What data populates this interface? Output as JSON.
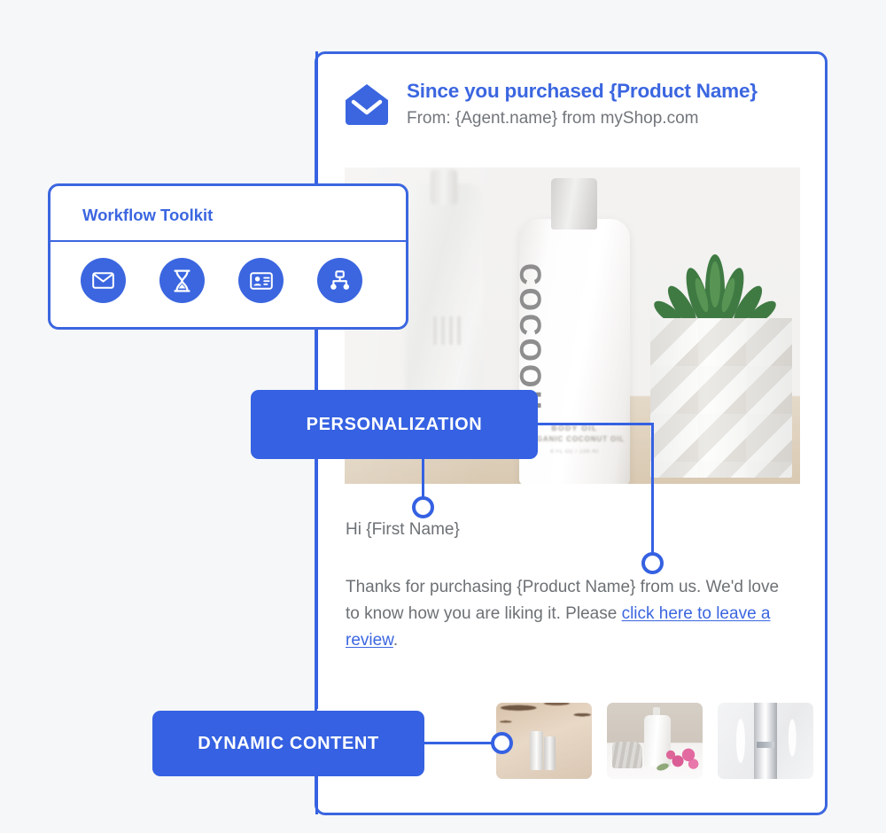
{
  "page": {
    "background_color": "#f6f7f8",
    "accent_color": "#3561e2"
  },
  "email_card": {
    "header": {
      "icon": "open-envelope-icon",
      "subject": "Since you purchased {Product Name}",
      "from": "From: {Agent.name} from myShop.com"
    },
    "hero_image": {
      "alt": "product-photo",
      "brand_text": "COCOOIL",
      "label_line1": "BODY OIL",
      "label_line2": "ORGANIC COCONUT OIL",
      "label_line3": "8 FL OZ / 236 ml"
    },
    "body": {
      "greeting": "Hi {First Name}",
      "paragraph_part1": "Thanks for purchasing {Product Name} from us. We'd love to know how you are liking it. Please ",
      "link_text": "click here to leave a review",
      "paragraph_part2": "."
    },
    "thumbnails": [
      {
        "name": "thumbnail-serum-branches"
      },
      {
        "name": "thumbnail-lotion-flowers"
      },
      {
        "name": "thumbnail-silver-device"
      }
    ]
  },
  "toolkit": {
    "title": "Workflow Toolkit",
    "tools": [
      {
        "name": "mail-icon",
        "label": "Mail"
      },
      {
        "name": "hourglass-icon",
        "label": "Wait"
      },
      {
        "name": "contact-card-icon",
        "label": "Contact"
      },
      {
        "name": "hierarchy-icon",
        "label": "Branch"
      }
    ]
  },
  "callouts": [
    {
      "name": "personalization-callout",
      "label": "PERSONALIZATION"
    },
    {
      "name": "dynamic-content-callout",
      "label": "DYNAMIC CONTENT"
    }
  ]
}
